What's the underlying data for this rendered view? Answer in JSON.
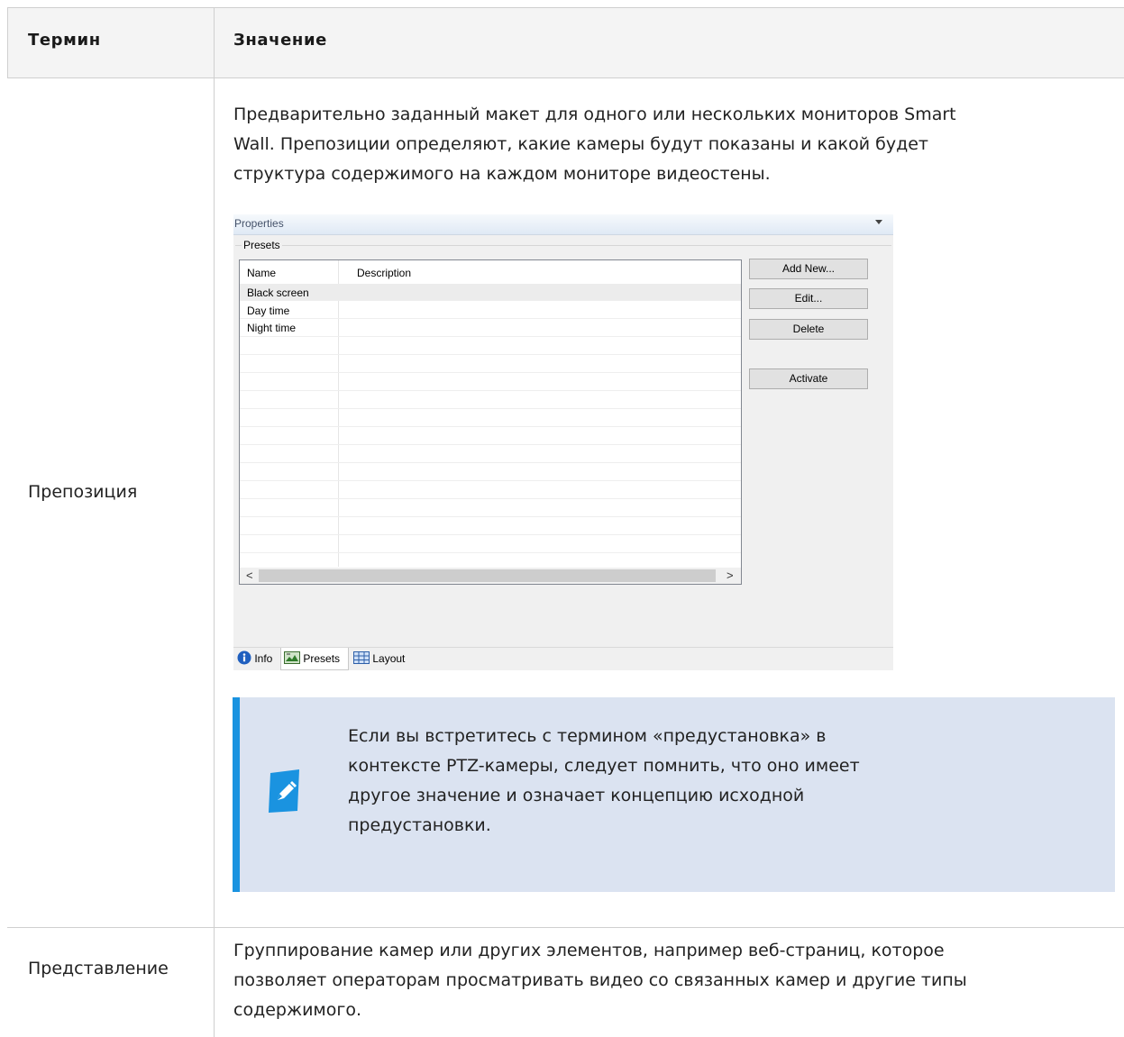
{
  "table": {
    "headers": {
      "term": "Термин",
      "meaning": "Значение"
    },
    "rows": [
      {
        "term": "Препозиция",
        "meaning_lines": [
          "Предварительно заданный макет для одного или нескольких мониторов Smart",
          "Wall. Препозиции определяют, какие камеры будут показаны и какой будет",
          "структура содержимого на каждом мониторе видеостены."
        ]
      },
      {
        "term": "Представление",
        "meaning_lines": [
          "Группирование камер или других элементов, например веб-страниц, которое",
          "позволяет операторам просматривать видео со связанных камер и другие типы",
          "содержимого."
        ]
      }
    ]
  },
  "screenshot": {
    "panel_title": "Properties",
    "group_label": "Presets",
    "columns": [
      "Name",
      "Description"
    ],
    "rows": [
      "Black screen",
      "Day time",
      "Night time"
    ],
    "buttons": {
      "add_new": "Add New...",
      "edit": "Edit...",
      "delete": "Delete",
      "activate": "Activate"
    },
    "tabs": [
      "Info",
      "Presets",
      "Layout"
    ],
    "scroll_left": "<",
    "scroll_right": ">"
  },
  "note": {
    "lines": [
      "Если вы встретитесь с термином «предустановка» в",
      "контексте PTZ-камеры, следует помнить, что оно имеет",
      "другое значение и означает концепцию исходной",
      "предустановки."
    ]
  },
  "colors": {
    "note_bar": "#1a93e0",
    "note_bg": "#dbe3f1",
    "header_bg": "#f4f4f4"
  }
}
